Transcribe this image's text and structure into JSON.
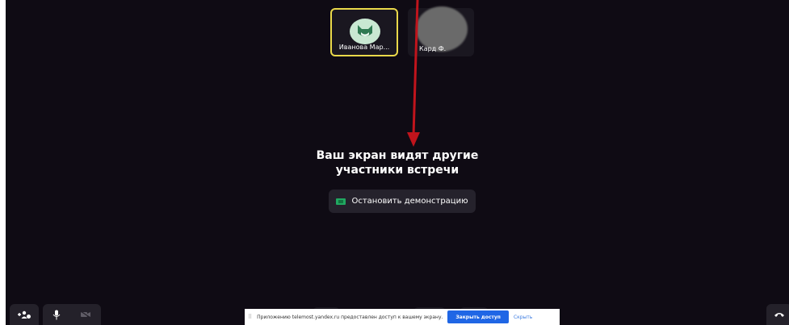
{
  "participants": [
    {
      "name": "Иванова Мар...",
      "active": true
    },
    {
      "name": "Кард          Ф.",
      "active": false
    }
  ],
  "screen_share": {
    "message_line1": "Ваш экран видят другие",
    "message_line2": "участники встречи",
    "stop_button_label": "Остановить демонстрацию"
  },
  "notification": {
    "grip": "⠿",
    "text": "Приложению telemost.yandex.ru предоставлен доступ к вашему экрану.",
    "close_access_label": "Закрыть доступ",
    "hide_label": "Скрыть"
  },
  "icons": {
    "avatar_green": "fox-avatar-icon",
    "add_participant": "add-person-icon",
    "mic": "microphone-icon",
    "camera": "camera-off-icon",
    "hangup": "hang-up-icon"
  },
  "colors": {
    "background": "#0f0b14",
    "active_border": "#ead94a",
    "annotation_arrow": "#c0141c",
    "primary_button": "#1f66e5"
  }
}
